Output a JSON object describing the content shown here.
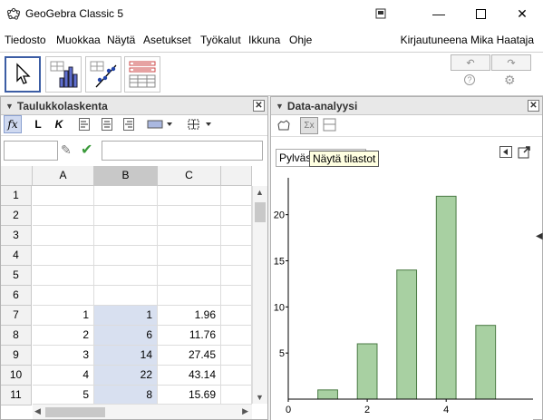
{
  "window": {
    "title": "GeoGebra Classic 5"
  },
  "menu": {
    "items": [
      "Tiedosto",
      "Muokkaa",
      "Näytä",
      "Asetukset",
      "Työkalut",
      "Ikkuna",
      "Ohje"
    ],
    "login": "Kirjautuneena Mika Haataja"
  },
  "toolbar": {
    "tools": [
      "move-tool",
      "one-variable-analysis-tool",
      "two-variable-regression-tool",
      "multiple-variable-analysis-tool"
    ],
    "undo_icon": "undo-icon",
    "redo_icon": "redo-icon",
    "help_icon": "help-icon",
    "settings_icon": "gear-icon"
  },
  "spreadsheet": {
    "title": "Taulukkolaskenta",
    "format_buttons": {
      "bold": "L",
      "italic": "K"
    },
    "fx": "fx",
    "columns": [
      "A",
      "B",
      "C"
    ],
    "rows": [
      "1",
      "2",
      "3",
      "4",
      "5",
      "6",
      "7",
      "8",
      "9",
      "10",
      "11"
    ],
    "cells": [
      [
        "",
        "",
        ""
      ],
      [
        "",
        "",
        ""
      ],
      [
        "",
        "",
        ""
      ],
      [
        "",
        "",
        ""
      ],
      [
        "",
        "",
        ""
      ],
      [
        "",
        "",
        ""
      ],
      [
        "1",
        "1",
        "1.96"
      ],
      [
        "2",
        "6",
        "11.76"
      ],
      [
        "3",
        "14",
        "27.45"
      ],
      [
        "4",
        "22",
        "43.14"
      ],
      [
        "5",
        "8",
        "15.69"
      ]
    ]
  },
  "analysis": {
    "title": "Data-analyysi",
    "chart_selector": "Pylväs",
    "tooltip": "Näytä tilastot",
    "sigma": "Σx"
  },
  "colors": {
    "bar_fill": "#a8d0a2",
    "bar_stroke": "#4a7a44",
    "selection": "#d8e0f0",
    "accent": "#3c5da4"
  },
  "chart_data": {
    "type": "bar",
    "x": [
      1,
      2,
      3,
      4,
      5
    ],
    "values": [
      1,
      6,
      14,
      22,
      8
    ],
    "title": "",
    "xlabel": "",
    "ylabel": "",
    "xticks": [
      "0",
      "2",
      "4"
    ],
    "yticks": [
      "5",
      "10",
      "15",
      "20"
    ],
    "xlim": [
      0,
      6.2
    ],
    "ylim": [
      0,
      24
    ],
    "grid": false
  }
}
